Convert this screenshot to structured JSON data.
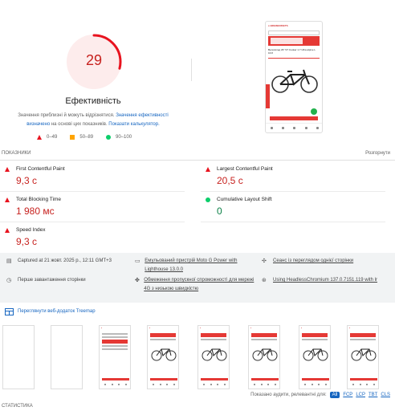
{
  "gauge": {
    "score": "29",
    "score_fraction": 0.29,
    "title": "Ефективність",
    "description_prefix": "Значення приблизні й можуть відрізнятися.",
    "description_link1": "Значення ефективності визначено",
    "description_middle": "на основі цих показників.",
    "description_link2": "Показати калькулятор."
  },
  "legend": [
    {
      "shape": "triangle",
      "color": "#e8131f",
      "label": "0–49"
    },
    {
      "shape": "square",
      "color": "#ffa400",
      "label": "50–89"
    },
    {
      "shape": "circle",
      "color": "#0cce6b",
      "label": "90–100"
    }
  ],
  "final_screenshot": {
    "logo": "● BIKEMARKETS",
    "product_title": "Велосипед 29\" ST Cooker 1.7 Ultra alpine L 16.8"
  },
  "metrics_header": {
    "label": "ПОКАЗНИКИ",
    "expand": "Розгорнути"
  },
  "metrics": [
    {
      "name": "First Contentful Paint",
      "value": "9,3 с",
      "status": "fail"
    },
    {
      "name": "Largest Contentful Paint",
      "value": "20,5 с",
      "status": "fail"
    },
    {
      "name": "Total Blocking Time",
      "value": "1 980 мс",
      "status": "fail"
    },
    {
      "name": "Cumulative Layout Shift",
      "value": "0",
      "status": "pass"
    },
    {
      "name": "Speed Index",
      "value": "9,3 с",
      "status": "fail"
    }
  ],
  "info": {
    "captured": "Captured at 21 жовт. 2025 р., 12:11 GMT+3",
    "emulation": "Емульований пристрій Moto G Power with Lighthouse 13.0.0",
    "session": "Сеанс із переглядом однієї сторінки",
    "first_load": "Перше завантаження сторінки",
    "throttling": "Обмеження пропускної спроможності для мережі 4G з низькою швидкістю",
    "browser": "Using HeadlessChromium 137.0.7151.119 with lr"
  },
  "treemap_button": "Переглянути веб-додаток Treemap",
  "audit_filter": {
    "prefix": "Показано аудити, релевантні для:",
    "chips": [
      "All",
      "FCP",
      "LCP",
      "TBT",
      "CLS"
    ]
  },
  "statistics_label": "СТАТИСТИКА",
  "colors": {
    "fail": "#c7221f",
    "pass": "#0a8046",
    "average": "#ffa400",
    "link": "#1565c0"
  }
}
